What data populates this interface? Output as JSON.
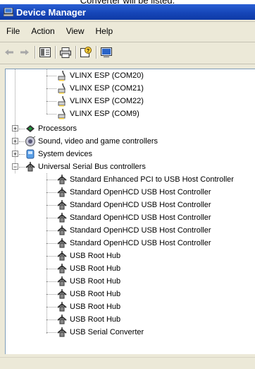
{
  "caption": "Converter will be listed.",
  "window": {
    "title": "Device Manager"
  },
  "menu": [
    "File",
    "Action",
    "View",
    "Help"
  ],
  "tree": {
    "ports": [
      "VLINX ESP (COM20)",
      "VLINX ESP (COM21)",
      "VLINX ESP (COM22)",
      "VLINX ESP (COM9)"
    ],
    "categories": [
      "Processors",
      "Sound, video and game controllers",
      "System devices",
      "Universal Serial Bus controllers"
    ],
    "usb_devices": [
      "Standard Enhanced PCI to USB Host Controller",
      "Standard OpenHCD USB Host Controller",
      "Standard OpenHCD USB Host Controller",
      "Standard OpenHCD USB Host Controller",
      "Standard OpenHCD USB Host Controller",
      "Standard OpenHCD USB Host Controller",
      "USB Root Hub",
      "USB Root Hub",
      "USB Root Hub",
      "USB Root Hub",
      "USB Root Hub",
      "USB Root Hub",
      "USB Serial Converter"
    ]
  },
  "icons": {
    "port": "port-connector-icon",
    "processor": "processor-icon",
    "sound": "speaker-icon",
    "system": "system-device-icon",
    "usb": "usb-plug-icon"
  }
}
